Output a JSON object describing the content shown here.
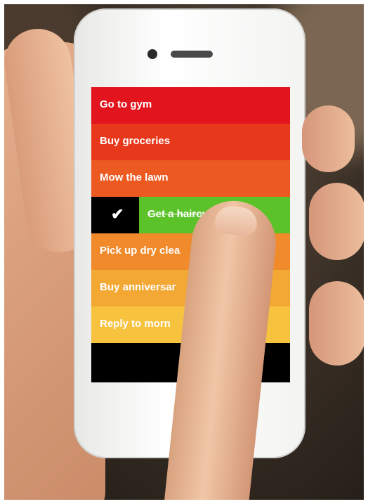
{
  "todo_list": {
    "items": [
      {
        "label": "Go to gym",
        "color": "#e2141e",
        "done": false
      },
      {
        "label": "Buy groceries",
        "color": "#e8381c",
        "done": false
      },
      {
        "label": "Mow the lawn",
        "color": "#ec5a22",
        "done": false
      },
      {
        "label": "Get a haircut",
        "color": "#5cc22a",
        "done": true
      },
      {
        "label": "Pick up dry clea",
        "color": "#f08a2a",
        "done": false
      },
      {
        "label": "Buy anniversar",
        "color": "#f4a834",
        "done": false
      },
      {
        "label": "Reply to morn",
        "color": "#f7c23e",
        "done": false
      }
    ],
    "check_icon": "checkmark-icon"
  }
}
